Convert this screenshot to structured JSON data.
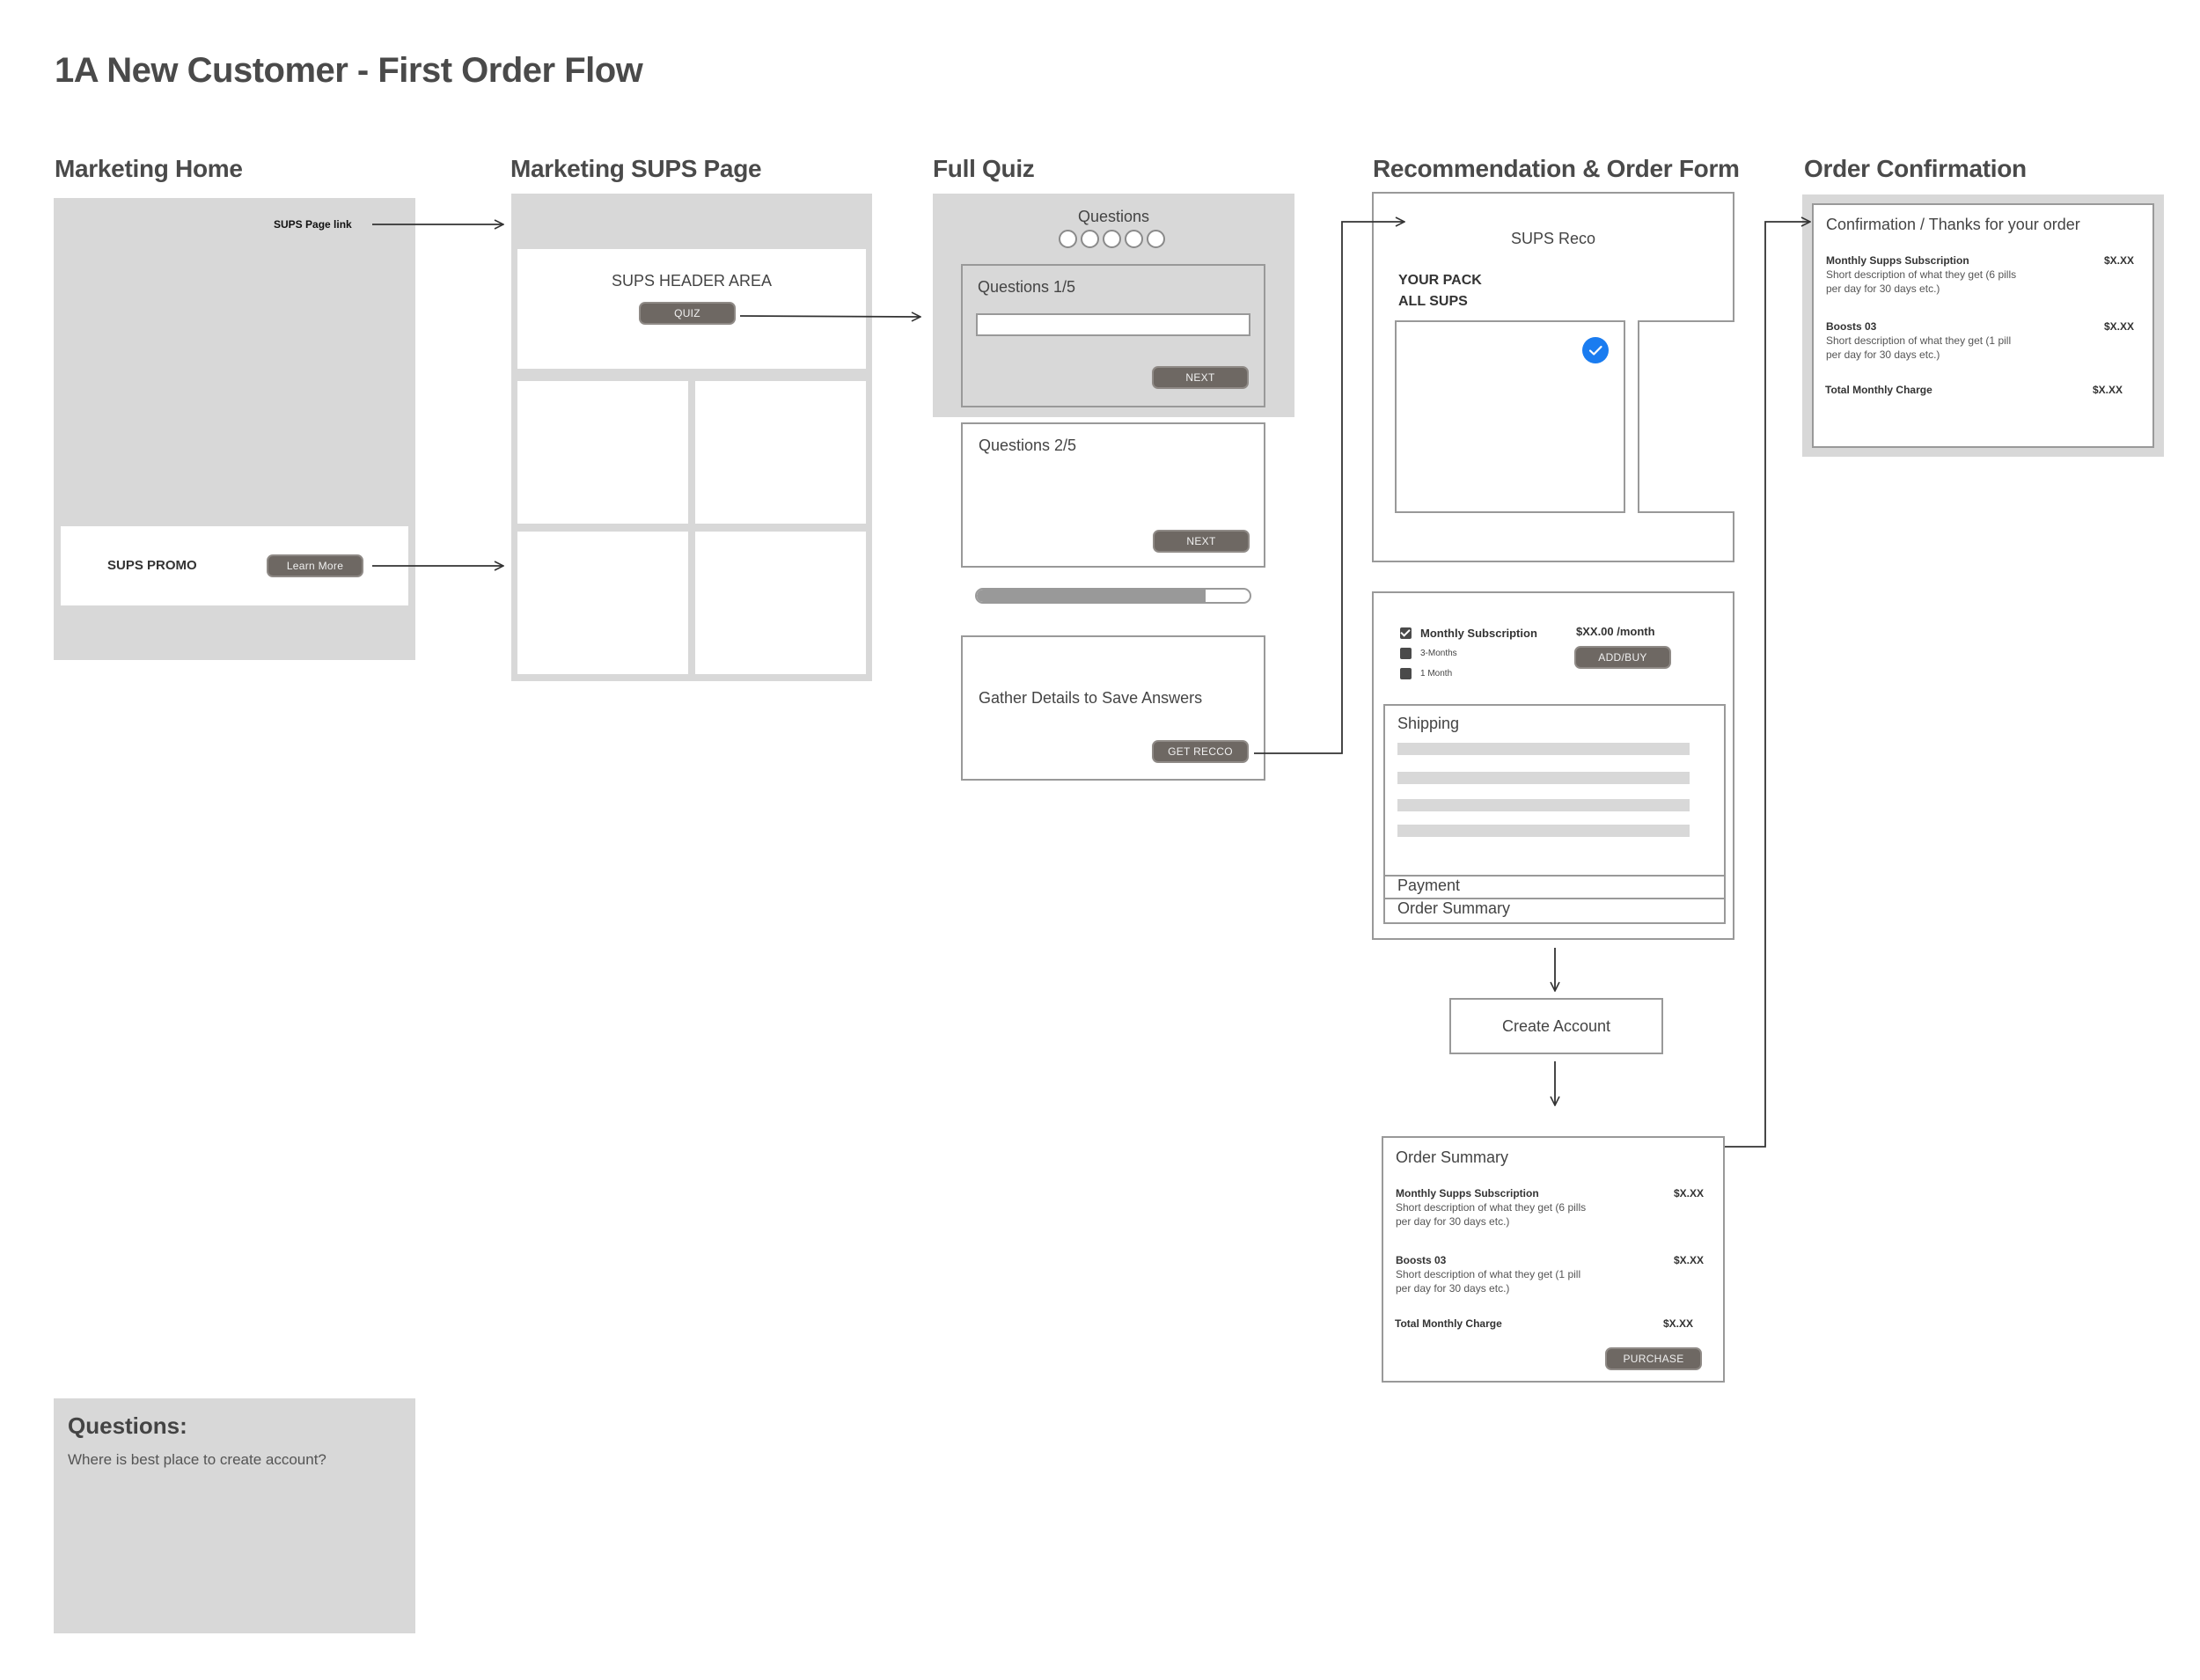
{
  "title": "1A New Customer - First Order Flow",
  "columns": {
    "marketing_home": "Marketing Home",
    "marketing_sups": "Marketing SUPS Page",
    "full_quiz": "Full Quiz",
    "reco_order": "Recommendation & Order Form",
    "confirmation": "Order Confirmation"
  },
  "marketing_home": {
    "sups_page_link": "SUPS Page link",
    "promo_label": "SUPS PROMO",
    "learn_more": "Learn More"
  },
  "marketing_sups": {
    "header_area": "SUPS HEADER AREA",
    "quiz_button": "QUIZ"
  },
  "quiz": {
    "questions_label": "Questions",
    "step_dots": 5,
    "q1_label": "Questions 1/5",
    "q1_input_value": "",
    "next_label": "NEXT",
    "q2_label": "Questions  2/5",
    "progress_percent": 84,
    "gather_label": "Gather Details to Save Answers",
    "get_recco": "GET RECCO"
  },
  "reco": {
    "title": "SUPS Reco",
    "your_pack": "YOUR PACK",
    "all_sups": "ALL SUPS",
    "selected_accent": "#1a7cf0"
  },
  "order_form": {
    "options": [
      {
        "label": "Monthly Subscription",
        "checked": true
      },
      {
        "label": "3-Months",
        "checked": false
      },
      {
        "label": "1 Month",
        "checked": false
      }
    ],
    "price": "$XX.00 /month",
    "add_buy": "ADD/BUY",
    "shipping": "Shipping",
    "payment": "Payment",
    "order_summary": "Order Summary"
  },
  "create_account": "Create Account",
  "order_summary": {
    "title": "Order Summary",
    "items": [
      {
        "name": "Monthly Supps Subscription",
        "desc1": "Short description of what they get (6 pills",
        "desc2": "per day for 30 days etc.)",
        "price": "$X.XX"
      },
      {
        "name": "Boosts 03",
        "desc1": "Short description of what they get (1 pill",
        "desc2": "per day for 30 days etc.)",
        "price": "$X.XX"
      }
    ],
    "total_label": "Total Monthly Charge",
    "total_price": "$X.XX",
    "purchase": "PURCHASE"
  },
  "confirmation": {
    "title": "Confirmation / Thanks for your order",
    "items": [
      {
        "name": "Monthly Supps Subscription",
        "desc1": "Short description of what they get (6 pills",
        "desc2": "per day for 30 days etc.)",
        "price": "$X.XX"
      },
      {
        "name": "Boosts 03",
        "desc1": "Short description of what they get (1 pill",
        "desc2": "per day for 30 days etc.)",
        "price": "$X.XX"
      }
    ],
    "total_label": "Total Monthly Charge",
    "total_price": "$X.XX"
  },
  "notes": {
    "heading": "Questions:",
    "text": "Where is best place to create account?"
  }
}
